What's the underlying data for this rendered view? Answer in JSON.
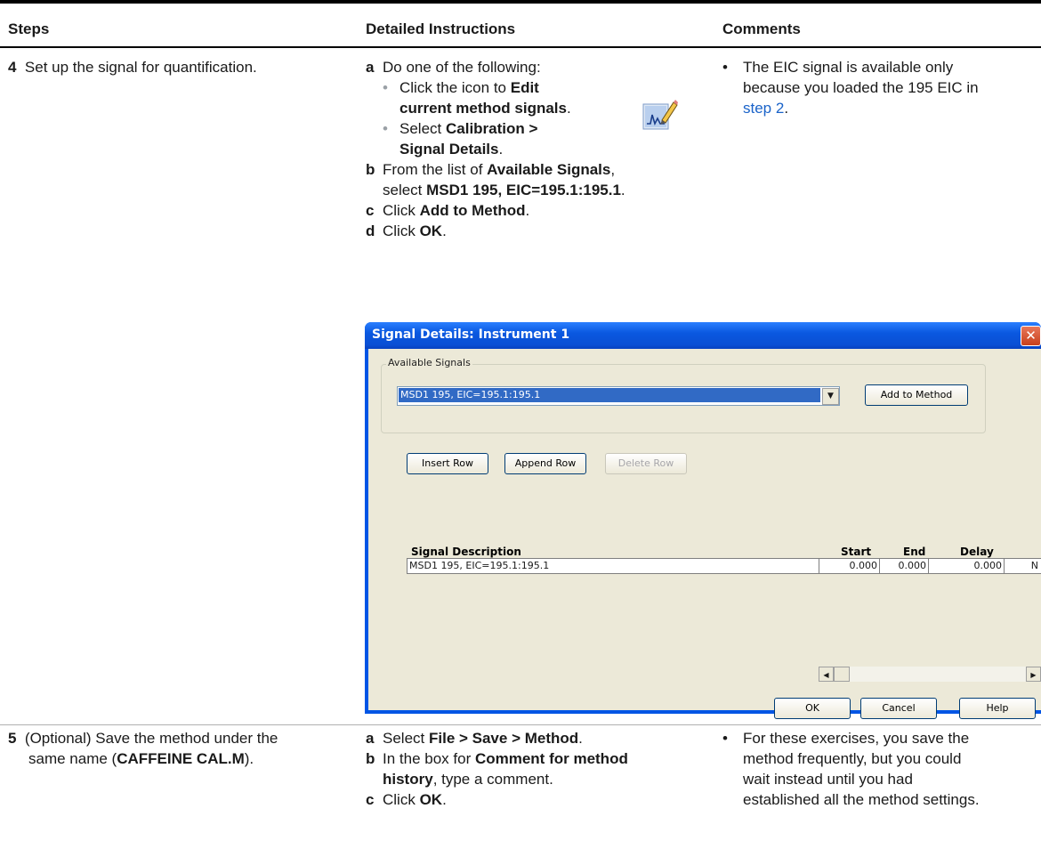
{
  "table": {
    "headers": {
      "steps": "Steps",
      "instructions": "Detailed Instructions",
      "comments": "Comments"
    },
    "step4": {
      "num": "4",
      "text": "Set up the signal for quantification.",
      "a_letter": "a",
      "a_text": "Do one of the following:",
      "a1_pre": "Click the icon to ",
      "a1_bold1": "Edit",
      "a1_bold2": "current method signals",
      "a1_post": ".",
      "a2_pre": "Select ",
      "a2_bold1": "Calibration >",
      "a2_bold2": "Signal Details",
      "a2_post": ".",
      "b_letter": "b",
      "b_pre": "From the list of ",
      "b_bold": "Available Signals",
      "b_post": ",",
      "b2_pre": "select ",
      "b2_bold": "MSD1 195, EIC=195.1:195.1",
      "b2_post": ".",
      "c_letter": "c",
      "c_pre": "Click ",
      "c_bold": "Add to Method",
      "c_post": ".",
      "d_letter": "d",
      "d_pre": "Click ",
      "d_bold": "OK",
      "d_post": ".",
      "comment_line1": "The EIC signal is available only",
      "comment_line2": "because you loaded the 195 EIC in",
      "comment_link": "step 2",
      "comment_post": "."
    },
    "step5": {
      "num": "5",
      "text_line1": "(Optional) Save the method under the",
      "text_line2_pre": "same name (",
      "text_line2_bold": "CAFFEINE CAL.M",
      "text_line2_post": ").",
      "a_letter": "a",
      "a_pre": "Select ",
      "a_bold": "File > Save > Method",
      "a_post": ".",
      "b_letter": "b",
      "b_pre": "In the box for ",
      "b_bold": "Comment for method",
      "b2_bold": "history",
      "b2_post": ", type a comment.",
      "c_letter": "c",
      "c_pre": "Click ",
      "c_bold": "OK",
      "c_post": ".",
      "comment_line1": "For these exercises, you save the",
      "comment_line2": "method frequently, but you could",
      "comment_line3": "wait instead until you had",
      "comment_line4": "established all the method settings."
    }
  },
  "dialog": {
    "title": "Signal Details: Instrument 1",
    "close": "✕",
    "group_label": "Available Signals",
    "combo_value": "MSD1 195, EIC=195.1:195.1",
    "add_to_method": "Add to Method",
    "insert_row": "Insert Row",
    "append_row": "Append Row",
    "delete_row": "Delete Row",
    "columns": {
      "desc": "Signal Description",
      "start": "Start",
      "end": "End",
      "delay": "Delay"
    },
    "row": {
      "desc": "MSD1 195, EIC=195.1:195.1",
      "start": "0.000",
      "end": "0.000",
      "delay": "0.000",
      "extra": "N"
    },
    "ok": "OK",
    "cancel": "Cancel",
    "help": "Help"
  },
  "colors": {
    "title_bar": "#0a58e0",
    "selection": "#316ac5",
    "link": "#1a63c9"
  },
  "icons": [
    "edit-signals-icon",
    "dropdown-arrow-icon",
    "scroll-left-icon",
    "scroll-right-icon",
    "close-icon"
  ]
}
